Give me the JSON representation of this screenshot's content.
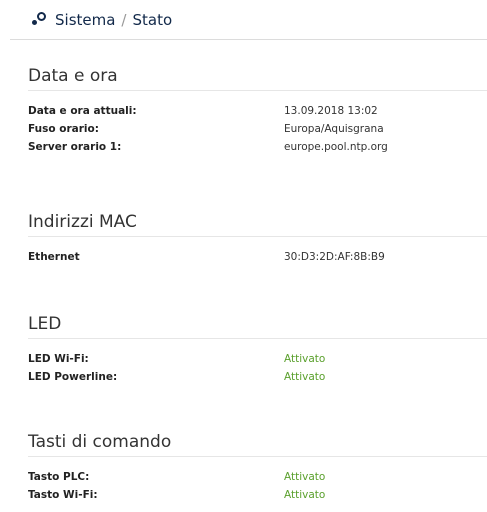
{
  "header": {
    "crumb_system": "Sistema",
    "separator": "/",
    "crumb_status": "Stato"
  },
  "sections": [
    {
      "title": "Data e ora",
      "rows": [
        {
          "label": "Data e ora attuali:",
          "value": "13.09.2018 13:02"
        },
        {
          "label": "Fuso orario:",
          "value": "Europa/Aquisgrana"
        },
        {
          "label": "Server orario 1:",
          "value": "europe.pool.ntp.org"
        }
      ]
    },
    {
      "title": "Indirizzi MAC",
      "rows": [
        {
          "label": "Ethernet",
          "value": "30:D3:2D:AF:8B:B9"
        }
      ]
    },
    {
      "title": "LED",
      "rows": [
        {
          "label": "LED Wi-Fi:",
          "value": "Attivato"
        },
        {
          "label": "LED Powerline:",
          "value": "Attivato"
        }
      ]
    },
    {
      "title": "Tasti di comando",
      "rows": [
        {
          "label": "Tasto PLC:",
          "value": "Attivato"
        },
        {
          "label": "Tasto Wi-Fi:",
          "value": "Attivato"
        }
      ]
    }
  ],
  "colors": {
    "brand": "#12294a",
    "enabled": "#5aa02c"
  }
}
